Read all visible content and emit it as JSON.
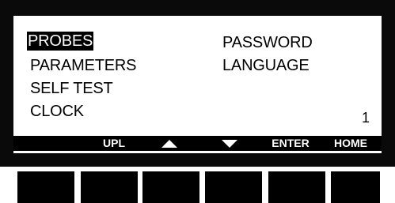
{
  "menu": {
    "items": [
      {
        "label": "PROBES",
        "selected": true
      },
      {
        "label": "PARAMETERS",
        "selected": false
      },
      {
        "label": "SELF TEST",
        "selected": false
      },
      {
        "label": "CLOCK",
        "selected": false
      },
      {
        "label": "PASSWORD",
        "selected": false
      },
      {
        "label": "LANGUAGE",
        "selected": false
      }
    ]
  },
  "page_number": "1",
  "softkeys": {
    "upl": "UPL",
    "up_icon": "arrow-up-icon",
    "down_icon": "arrow-down-icon",
    "enter": "ENTER",
    "home": "HOME"
  },
  "colors": {
    "bezel": "#0a0a0a",
    "screen": "#ffffff",
    "text": "#000000",
    "selection": "#000000"
  }
}
